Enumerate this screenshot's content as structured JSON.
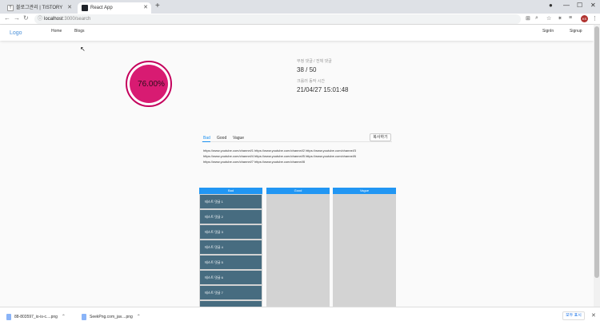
{
  "browser": {
    "tabs": [
      {
        "title": "블로그관리 | TISTORY",
        "favicon": "T"
      },
      {
        "title": "React App"
      }
    ],
    "new_tab": "+",
    "address": {
      "host": "localhost",
      "path": ":3000/search"
    },
    "profile_initials": "KS"
  },
  "nav": {
    "logo": "Logo",
    "links": [
      "Home",
      "Blogs"
    ],
    "signin": "SignIn",
    "signup": "Signup"
  },
  "gauge": {
    "percent_label": "76.00%",
    "percent": 76
  },
  "stats": {
    "label1": "부정 댓글 / 전체 댓글",
    "value1": "38 / 50",
    "label2": "크롤러 동작 시간",
    "value2": "21/04/27 15:01:48"
  },
  "result_tabs": {
    "items": [
      "Bad",
      "Good",
      "Vague"
    ],
    "active": "Bad",
    "copy_button": "복사하기"
  },
  "urls": [
    "https://www.youtube.com/channel/1 https://www.youtube.com/channel/2 https://www.youtube.com/channel/3",
    "https://www.youtube.com/channel/4 https://www.youtube.com/channel/5 https://www.youtube.com/channel/6",
    "https://www.youtube.com/channel/7 https://www.youtube.com/channel/8"
  ],
  "columns": {
    "headers": [
      "Bad",
      "Good",
      "Vague"
    ],
    "bad_cards": [
      "테스트 댓글 1",
      "테스트 댓글 2",
      "테스트 댓글 3",
      "테스트 댓글 4",
      "테스트 댓글 5",
      "테스트 댓글 6",
      "테스트 댓글 7"
    ]
  },
  "downloads": {
    "items": [
      "88-803597_io-is-c....png",
      "SeekPng.com_jav....png"
    ],
    "show_all": "모두 표시"
  },
  "colors": {
    "accent": "#2196f3",
    "gauge": "#d81b72",
    "card": "#476c80"
  }
}
